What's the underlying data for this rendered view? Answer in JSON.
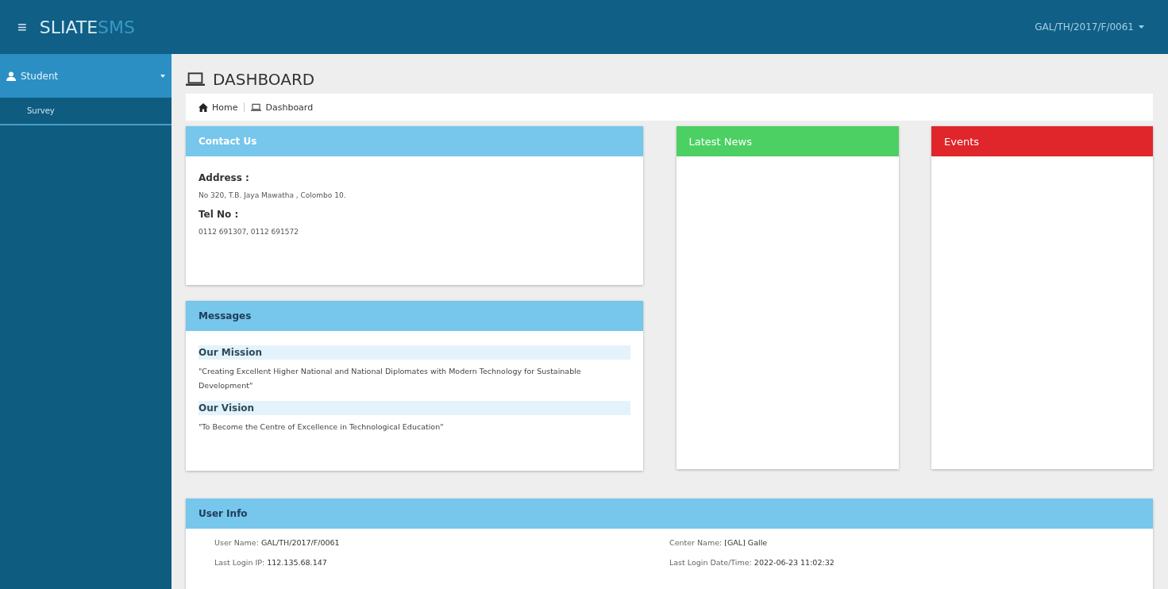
{
  "topbar": {
    "menu_glyph": "≡",
    "brand": "SLIATE",
    "brand_suffix": "SMS",
    "user": "GAL/TH/2017/F/0061"
  },
  "sidebar": {
    "items": [
      {
        "label": "Student",
        "selected": true,
        "expanded": true,
        "children": [
          {
            "label": "Survey",
            "selected": false
          }
        ]
      }
    ]
  },
  "page": {
    "title": "DASHBOARD",
    "breadcrumb": [
      {
        "label": "Home",
        "kind": "home"
      },
      {
        "label": "Dashboard",
        "kind": "laptop"
      }
    ]
  },
  "contact": {
    "title": "Contact Us",
    "fields": [
      {
        "label": "Address :",
        "value": "No 320, T.B. Jaya Mawatha , Colombo 10."
      },
      {
        "label": "Tel No :",
        "value": "0112 691307, 0112 691572"
      }
    ]
  },
  "messages": {
    "title": "Messages",
    "sections": [
      {
        "heading": "Our Mission",
        "text": "\"Creating Excellent Higher National and National Diplomates with Modern Technology for Sustainable Development\""
      },
      {
        "heading": "Our Vision",
        "text": "\"To Become the Centre of Excellence in Technological Education\""
      }
    ]
  },
  "panels": [
    {
      "title": "Latest News",
      "color": "#4cd063"
    },
    {
      "title": "Events",
      "color": "#e0262b"
    }
  ],
  "user_info": {
    "title": "User Info",
    "items": [
      "User Name: **GAL/TH/2017/F/0061**",
      "Center Name: **[GAL] Galle**",
      "Last Login IP: **112.135.68.147**",
      "Last Login Date/Time: **2022-06-23 11:02:32**"
    ]
  }
}
